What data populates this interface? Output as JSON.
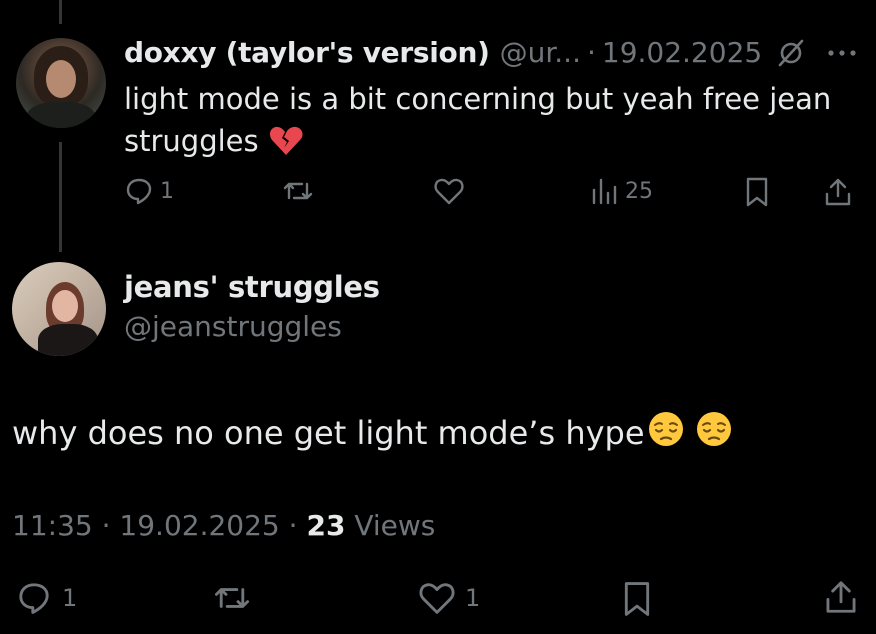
{
  "reply_tweet": {
    "display_name": "doxxy (taylor's version)",
    "handle": "@ur...",
    "separator": "·",
    "date": "19.02.2025",
    "text": "light mode is a bit concerning but yeah free jean struggles",
    "emoji": "broken-heart",
    "actions": {
      "reply_count": "1",
      "retweet_count": "",
      "like_count": "",
      "views_count": "25"
    },
    "icons": [
      "reply-icon",
      "retweet-icon",
      "like-icon",
      "views-icon",
      "bookmark-icon",
      "share-icon",
      "grok-icon",
      "more-icon"
    ]
  },
  "main_tweet": {
    "display_name": "jeans' struggles",
    "handle": "@jeanstruggles",
    "text": "why does no one get light mode’s hype",
    "emojis": [
      "pensive-face",
      "pensive-face"
    ],
    "time": "11:35",
    "separator": "·",
    "date": "19.02.2025",
    "separator2": "·",
    "views_number": "23",
    "views_label": "Views",
    "actions": {
      "reply_count": "1",
      "retweet_count": "",
      "like_count": "1"
    }
  },
  "colors": {
    "background": "#000000",
    "text_primary": "#e7e9ea",
    "text_muted": "#71767b",
    "thread_line": "#333639",
    "emoji_yellow": "#ffc83d",
    "broken_heart": "#e8474f"
  }
}
